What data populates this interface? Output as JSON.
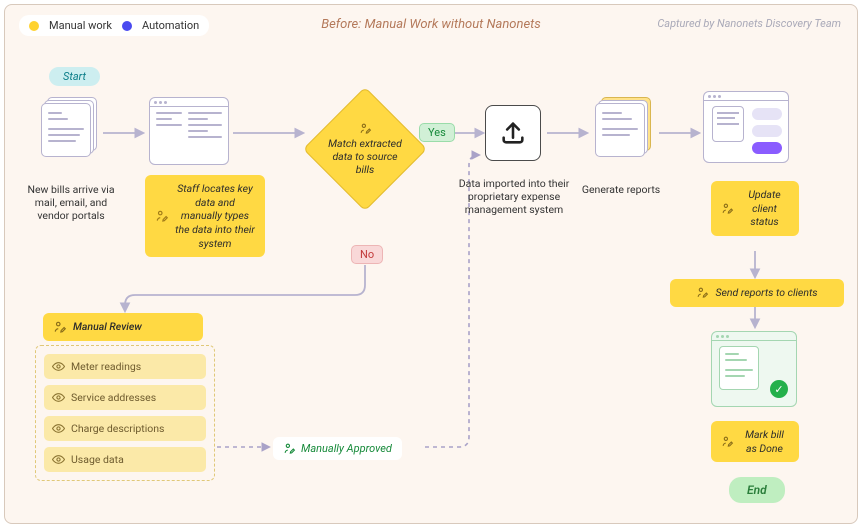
{
  "legend": {
    "manual": "Manual work",
    "automation": "Automation"
  },
  "title": "Before: Manual Work without Nanonets",
  "caption": "Captured by Nanonets Discovery Team",
  "start": "Start",
  "end": "End",
  "nodes": {
    "new_bills": "New bills arrive via mail, email, and vendor portals",
    "staff_locates": "Staff locates key data and manually types the data into their system",
    "match_extract": "Match extracted data to source bills",
    "yes": "Yes",
    "no": "No",
    "imported": "Data imported into their proprietary expense management system",
    "generate_reports": "Generate reports",
    "update_client": "Update client status",
    "send_reports": "Send reports to clients",
    "mark_done": "Mark bill as Done"
  },
  "manual_review": {
    "title": "Manual Review",
    "items": [
      "Meter readings",
      "Service addresses",
      "Charge descriptions",
      "Usage data"
    ]
  },
  "approved": "Manually Approved"
}
